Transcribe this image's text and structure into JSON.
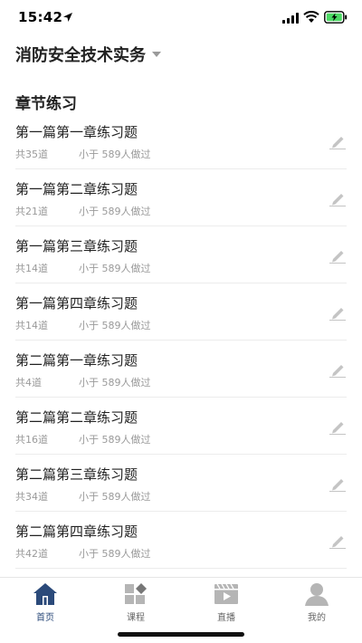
{
  "status_bar": {
    "time": "15:42"
  },
  "subject": {
    "title": "消防安全技术实务"
  },
  "section": {
    "title": "章节练习"
  },
  "chapters": [
    {
      "title": "第一篇第一章练习题",
      "count": "共35道",
      "people": "小于 589人做过"
    },
    {
      "title": "第一篇第二章练习题",
      "count": "共21道",
      "people": "小于 589人做过"
    },
    {
      "title": "第一篇第三章练习题",
      "count": "共14道",
      "people": "小于 589人做过"
    },
    {
      "title": "第一篇第四章练习题",
      "count": "共14道",
      "people": "小于 589人做过"
    },
    {
      "title": "第二篇第一章练习题",
      "count": "共4道",
      "people": "小于 589人做过"
    },
    {
      "title": "第二篇第二章练习题",
      "count": "共16道",
      "people": "小于 589人做过"
    },
    {
      "title": "第二篇第三章练习题",
      "count": "共34道",
      "people": "小于 589人做过"
    },
    {
      "title": "第二篇第四章练习题",
      "count": "共42道",
      "people": "小于 589人做过"
    }
  ],
  "tabs": [
    {
      "label": "首页",
      "icon": "home-icon",
      "active": true
    },
    {
      "label": "课程",
      "icon": "course-icon",
      "active": false
    },
    {
      "label": "直播",
      "icon": "live-video-icon",
      "active": false
    },
    {
      "label": "我的",
      "icon": "profile-icon",
      "active": false
    }
  ],
  "colors": {
    "accent": "#2b4a7a",
    "muted": "#9a9a9a",
    "icon_gray": "#b5b5b5",
    "battery_green": "#4cd964"
  }
}
